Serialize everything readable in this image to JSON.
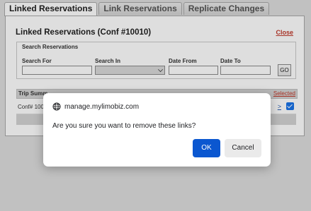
{
  "tabs": [
    {
      "label": "Linked Reservations",
      "active": true
    },
    {
      "label": "Link Reservations",
      "active": false
    },
    {
      "label": "Replicate Changes",
      "active": false
    }
  ],
  "panel": {
    "title": "Linked Reservations (Conf #10010)",
    "close_label": "Close"
  },
  "search": {
    "legend": "Search Reservations",
    "search_for_label": "Search For",
    "search_for_value": "",
    "search_in_label": "Search In",
    "search_in_value": "",
    "date_from_label": "Date From",
    "date_from_value": "",
    "date_to_label": "Date To",
    "date_to_value": "",
    "go_label": "GO"
  },
  "results": {
    "header_trip_visible": "Trip Summ",
    "header_selected_visible": "Selected",
    "rows": [
      {
        "conf_visible": "Conf# 1001",
        "view_link_visible": ">",
        "selected": true
      }
    ]
  },
  "dialog": {
    "origin": "manage.mylimobiz.com",
    "message": "Are you sure you want to remove these links?",
    "ok_label": "OK",
    "cancel_label": "Cancel"
  },
  "colors": {
    "primary_button": "#0b57d0",
    "close_link": "#c0392b",
    "checkbox": "#1a73e8"
  }
}
